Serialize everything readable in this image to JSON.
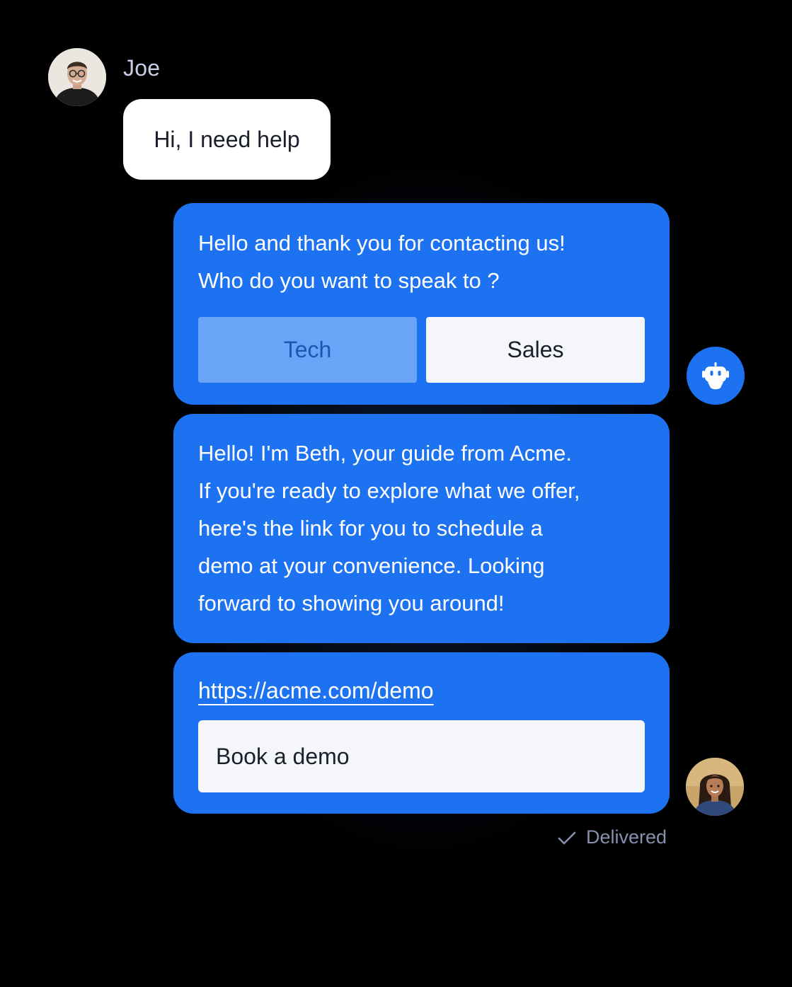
{
  "conversation": {
    "user": {
      "name": "Joe",
      "avatar_icon": "user-avatar-photo",
      "message": "Hi, I need help"
    },
    "bot_message_1": {
      "line1": "Hello and thank you for contacting us!",
      "line2": "Who do you want to speak to ?",
      "options": [
        "Tech",
        "Sales"
      ]
    },
    "bot_message_2": {
      "lines": [
        "Hello! I'm Beth, your guide from Acme.",
        "If you're ready to explore what we offer,",
        "here's the link for you to schedule a",
        "demo at your convenience. Looking",
        "forward to showing you around!"
      ]
    },
    "bot_message_3": {
      "link": "https://acme.com/demo",
      "cta": "Book a demo"
    },
    "bot_avatar_icon": "robot-icon",
    "agent_avatar_icon": "agent-avatar-photo",
    "status": {
      "icon": "check-icon",
      "text": "Delivered"
    }
  },
  "colors": {
    "background": "#000000",
    "bot_bubble": "#1d72f2",
    "user_bubble": "#ffffff",
    "selected_option": "#6aa4f7",
    "option": "#f5f6fa",
    "status_text": "#8790ae"
  }
}
